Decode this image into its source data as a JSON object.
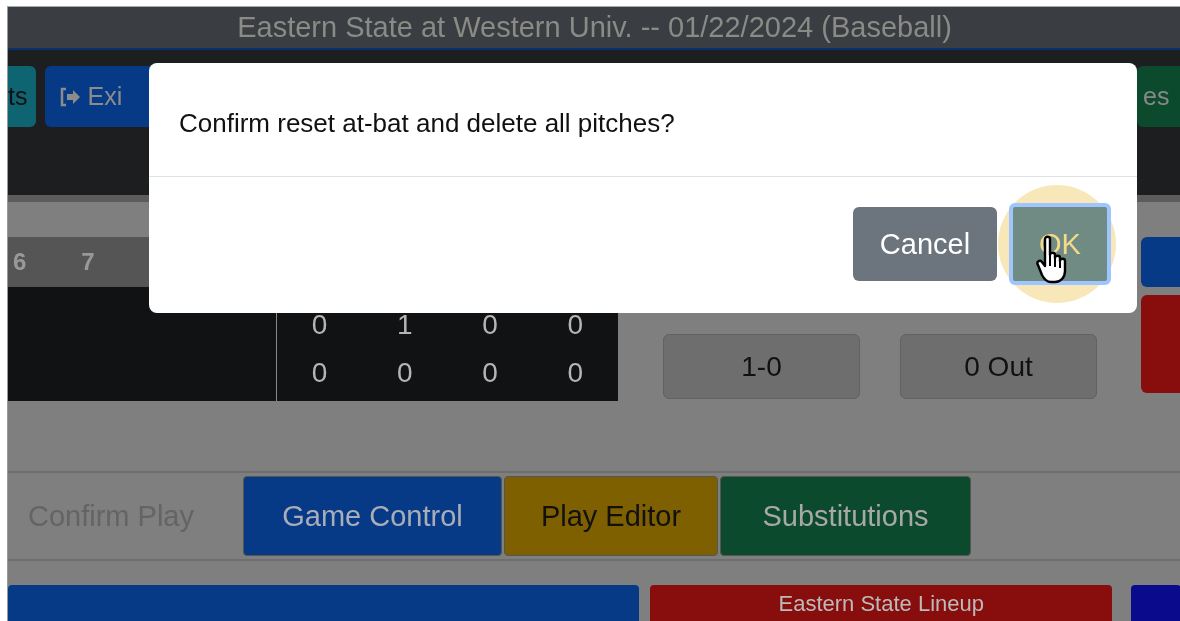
{
  "window": {
    "title": "Eastern State at Western Univ. -- 01/22/2024 (Baseball)"
  },
  "toolbar": {
    "left": [
      {
        "label": "ts",
        "kind": "teal"
      },
      {
        "label": "Exi",
        "kind": "exit"
      }
    ],
    "right": [
      {
        "label": "es",
        "kind": "green"
      }
    ]
  },
  "scoreboard": {
    "innings": [
      "6",
      "7"
    ],
    "rows": [
      {
        "cells": [
          "0",
          "1",
          "0",
          "0"
        ]
      },
      {
        "cells": [
          "0",
          "0",
          "0",
          "0"
        ]
      }
    ]
  },
  "count": [
    "1-0",
    "0 Out"
  ],
  "side_buttons": [
    {
      "kind": "blue"
    },
    {
      "kind": "red"
    }
  ],
  "tabs": [
    {
      "label": "Confirm Play",
      "kind": "plain"
    },
    {
      "label": "Game Control",
      "kind": "blue"
    },
    {
      "label": "Play Editor",
      "kind": "gold"
    },
    {
      "label": "Substitutions",
      "kind": "green"
    }
  ],
  "lineup_bars": [
    {
      "kind": "blue"
    },
    {
      "kind": "red",
      "label": "Eastern State Lineup"
    },
    {
      "kind": "navy"
    }
  ],
  "dialog": {
    "message": "Confirm reset at-bat and delete all pitches?",
    "buttons": [
      {
        "label": "Cancel",
        "kind": "secondary",
        "focused": false
      },
      {
        "label": "OK",
        "kind": "primary",
        "focused": true
      }
    ]
  }
}
